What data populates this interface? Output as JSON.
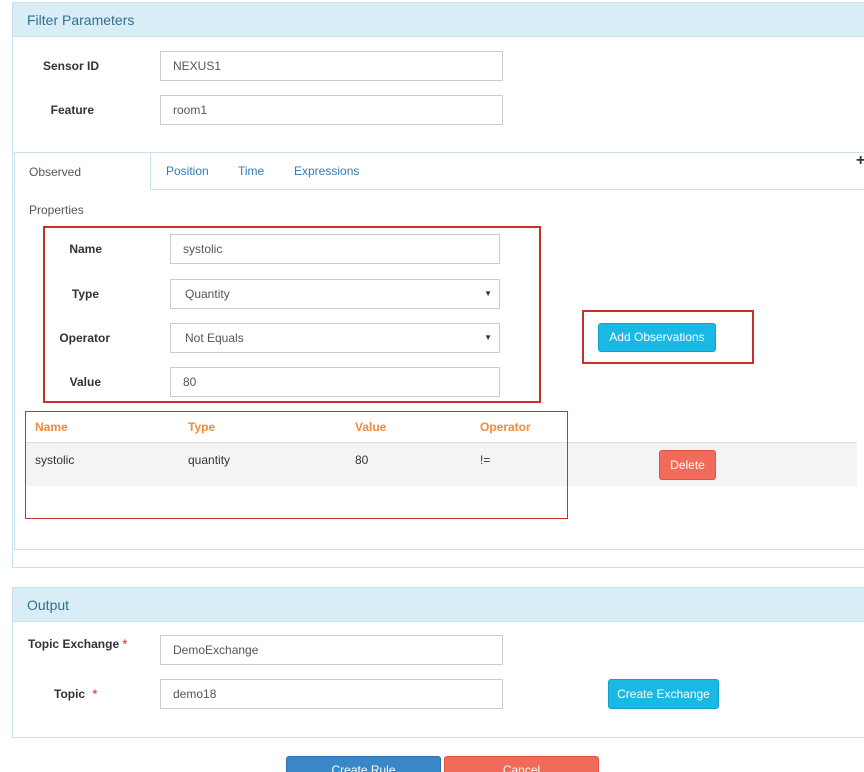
{
  "filter": {
    "title": "Filter Parameters",
    "sensor_id_label": "Sensor ID",
    "sensor_id_value": "NEXUS1",
    "feature_label": "Feature",
    "feature_value": "room1"
  },
  "tabs": [
    {
      "label": "Observed Properties",
      "active": true
    },
    {
      "label": "Position",
      "active": false
    },
    {
      "label": "Time",
      "active": false
    },
    {
      "label": "Expressions",
      "active": false
    }
  ],
  "observation_form": {
    "name_label": "Name",
    "name_value": "systolic",
    "type_label": "Type",
    "type_value": "Quantity",
    "operator_label": "Operator",
    "operator_value": "Not Equals",
    "value_label": "Value",
    "value_value": "80",
    "add_button": "Add Observations"
  },
  "observations_table": {
    "headers": [
      "Name",
      "Type",
      "Value",
      "Operator"
    ],
    "rows": [
      {
        "name": "systolic",
        "type": "quantity",
        "value": "80",
        "operator": "!=",
        "delete_label": "Delete"
      }
    ]
  },
  "output": {
    "title": "Output",
    "topic_exchange_label": "Topic Exchange",
    "topic_exchange_value": "DemoExchange",
    "topic_label": "Topic",
    "topic_value": "demo18",
    "required_mark": "*",
    "create_exchange_button": "Create Exchange"
  },
  "footer": {
    "create_rule_button": "Create Rule",
    "cancel_button": "Cancel"
  },
  "colors": {
    "panel_header_bg": "#d9edf7",
    "highlight_box": "#c9302c",
    "table_header_text": "#f08b3c",
    "info_button": "#1ab8e4",
    "danger_button": "#f16b5a"
  }
}
